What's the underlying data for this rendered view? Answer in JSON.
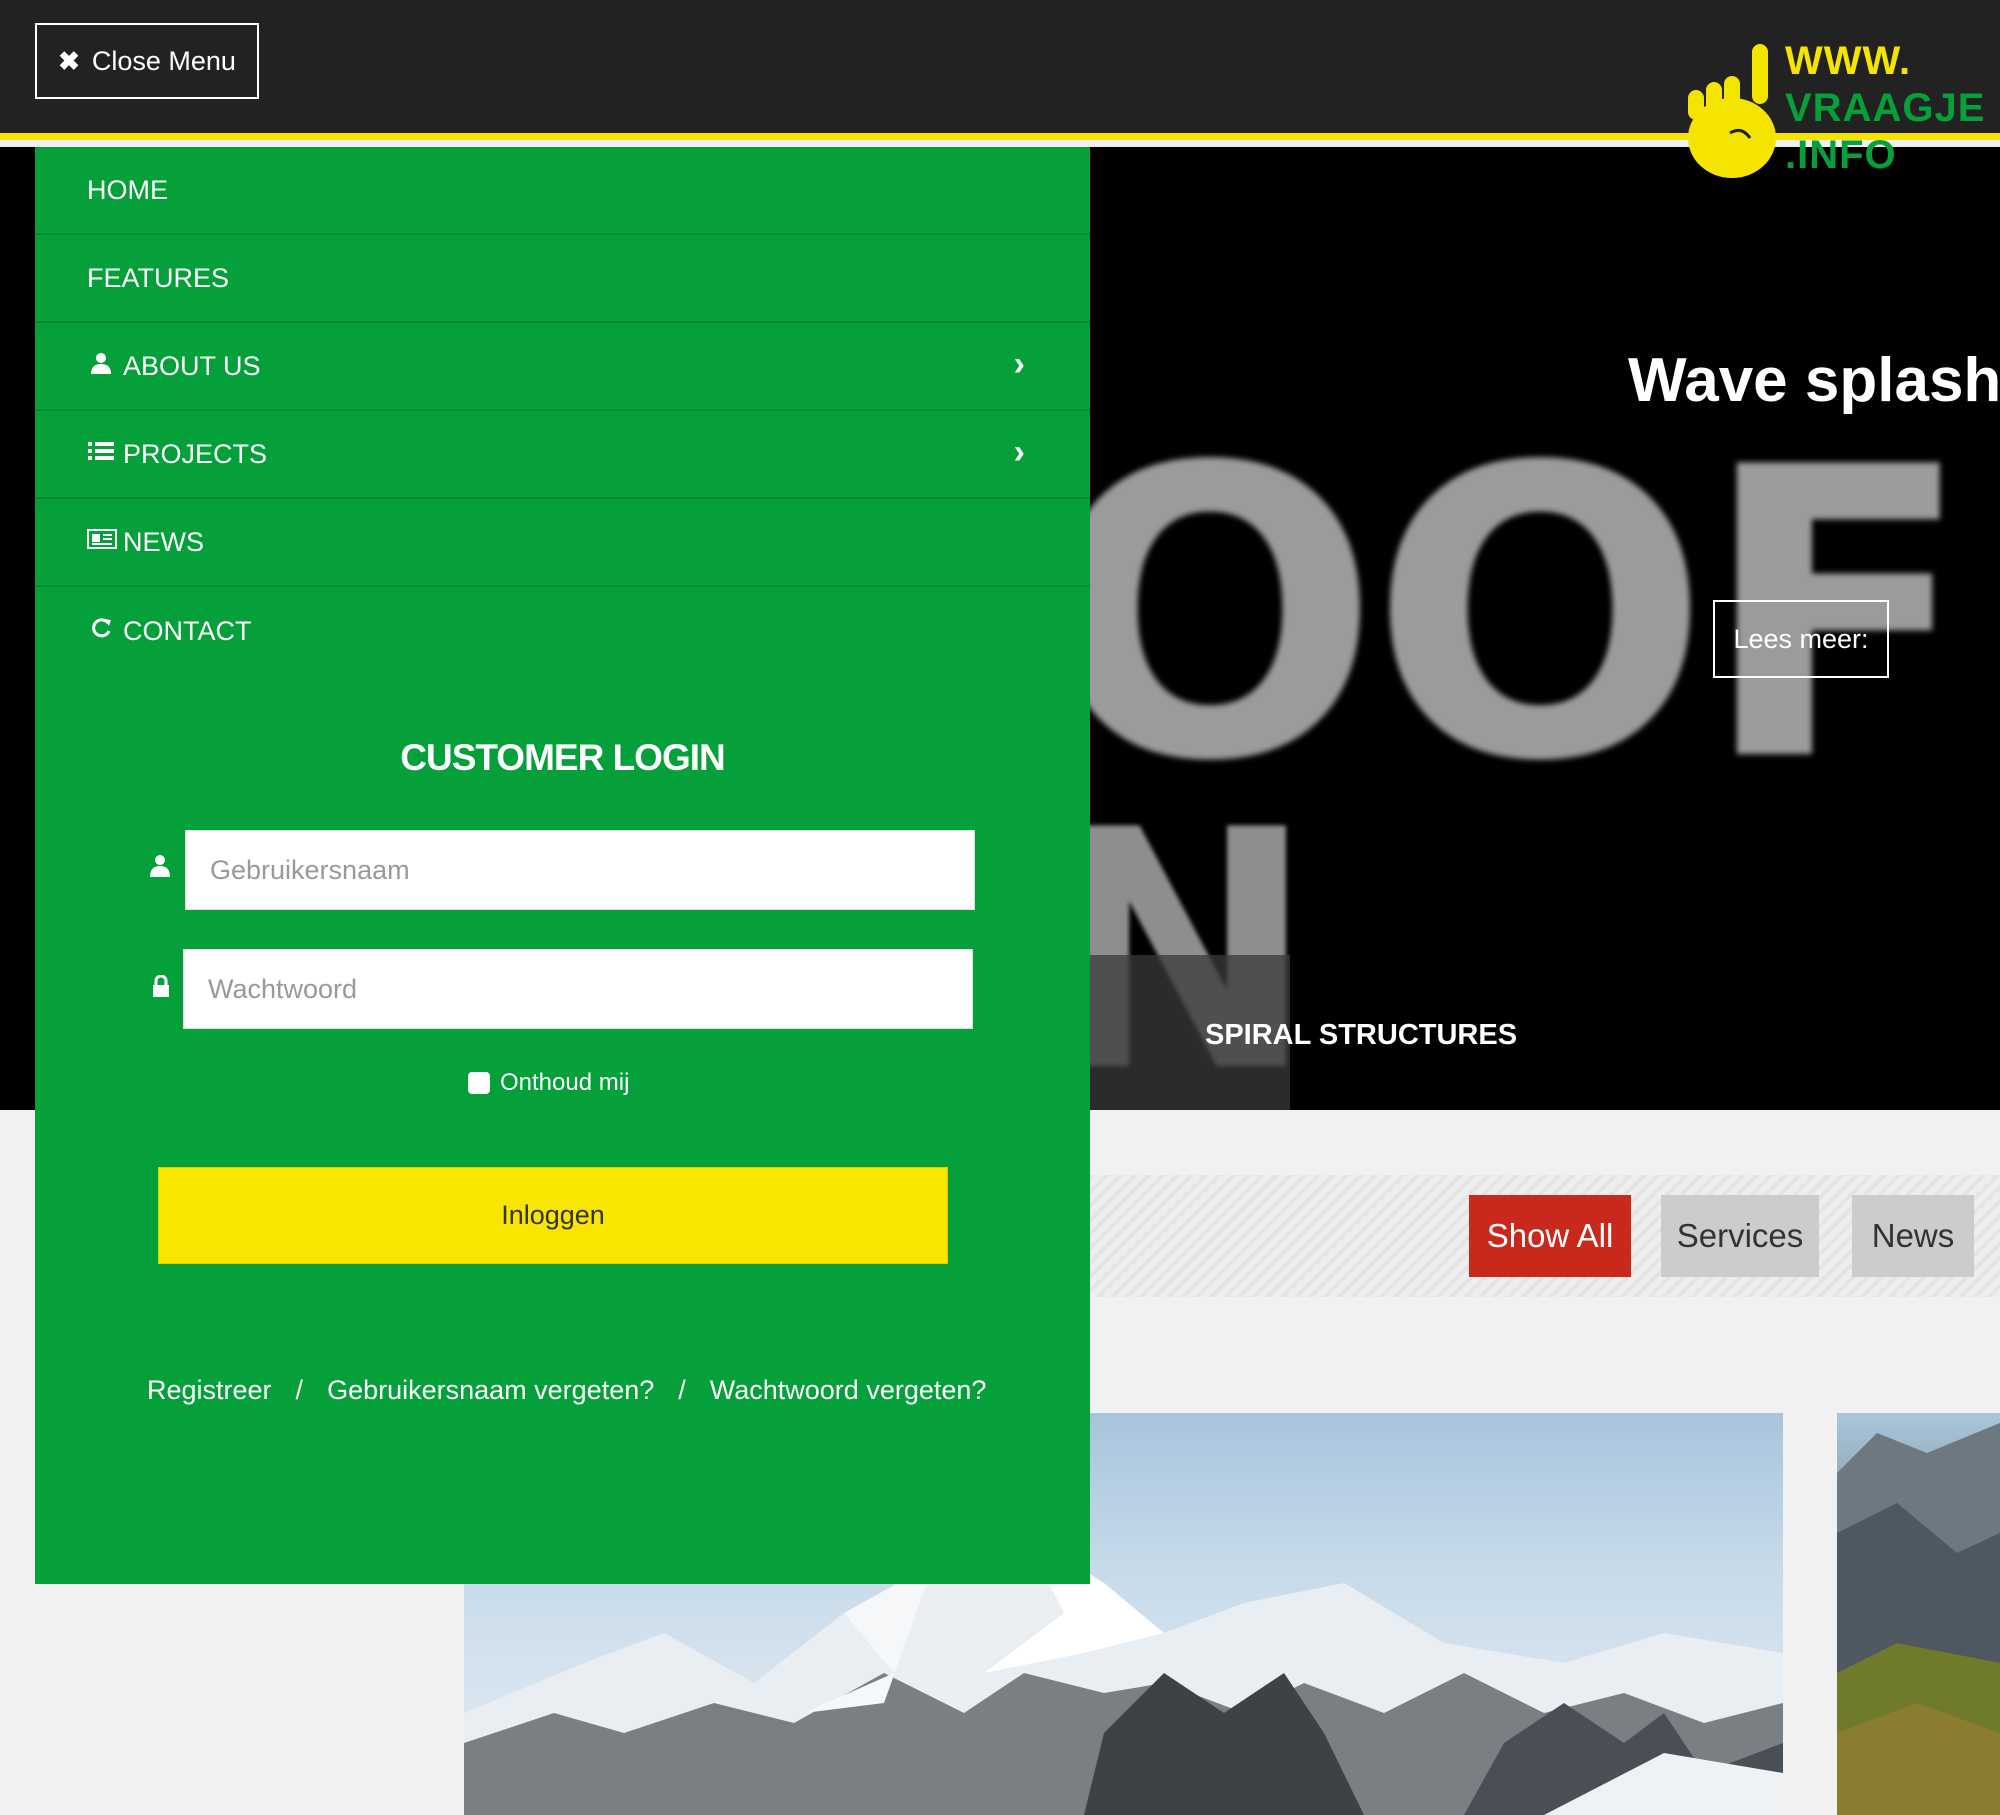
{
  "topbar": {
    "close_label": "Close Menu",
    "close_icon": "close-icon"
  },
  "logo": {
    "line1": "WWW.",
    "line2": "VRAAGJE",
    "line3": ".INFO",
    "colors": {
      "yellow": "#f5e400",
      "green": "#05a03a"
    }
  },
  "hero": {
    "title": "Wave splash",
    "button_label": "Lees meer:",
    "caption": "SPIRAL STRUCTURES"
  },
  "menu": {
    "items": [
      {
        "label": "HOME",
        "icon": ""
      },
      {
        "label": "FEATURES",
        "icon": ""
      },
      {
        "label": "ABOUT US",
        "icon": "user-icon",
        "has_submenu": true
      },
      {
        "label": "PROJECTS",
        "icon": "list-icon",
        "has_submenu": true
      },
      {
        "label": "NEWS",
        "icon": "newspaper-icon"
      },
      {
        "label": "CONTACT",
        "icon": "refresh-icon"
      }
    ]
  },
  "login": {
    "title": "CUSTOMER LOGIN",
    "username_placeholder": "Gebruikersnaam",
    "password_placeholder": "Wachtwoord",
    "remember_label": "Onthoud mij",
    "submit_label": "Inloggen",
    "links": [
      "Registreer",
      "/",
      "Gebruikersnaam vergeten?",
      "/",
      "Wachtwoord vergeten?"
    ]
  },
  "filters": {
    "buttons": [
      "Show All",
      "Services",
      "News"
    ],
    "active": "Show All",
    "active_color": "#c9281c"
  }
}
